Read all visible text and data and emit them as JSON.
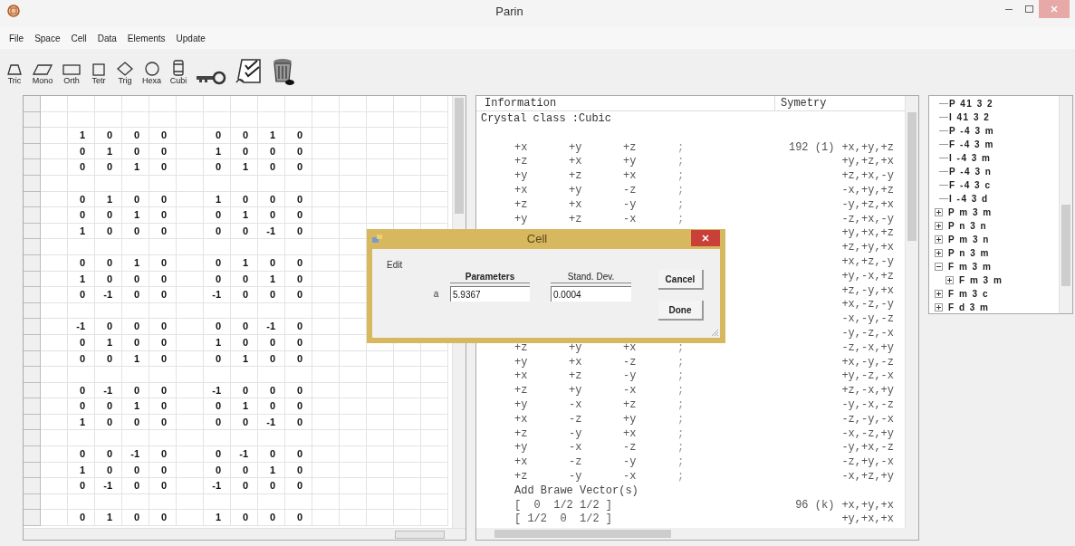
{
  "window": {
    "title": "Parin"
  },
  "menu": [
    "File",
    "Space",
    "Cell",
    "Data",
    "Elements",
    "Update"
  ],
  "toolbar": [
    {
      "label": "Tric",
      "kind": "trapezoid"
    },
    {
      "label": "Mono",
      "kind": "parallelogram"
    },
    {
      "label": "Orth",
      "kind": "rectangle"
    },
    {
      "label": "Tetr",
      "kind": "square"
    },
    {
      "label": "Trig",
      "kind": "diamond"
    },
    {
      "label": "Hexa",
      "kind": "circle"
    },
    {
      "label": "Cubi",
      "kind": "cylinder"
    },
    {
      "kind": "key"
    },
    {
      "kind": "checklist"
    },
    {
      "kind": "trash"
    }
  ],
  "matrix_grid": {
    "groups": [
      {
        "rows": [
          [
            "1",
            "0",
            "0",
            "0",
            "0",
            "0",
            "1",
            "0"
          ],
          [
            "0",
            "1",
            "0",
            "0",
            "1",
            "0",
            "0",
            "0"
          ],
          [
            "0",
            "0",
            "1",
            "0",
            "0",
            "1",
            "0",
            "0"
          ]
        ]
      },
      {
        "rows": [
          [
            "0",
            "1",
            "0",
            "0",
            "1",
            "0",
            "0",
            "0"
          ],
          [
            "0",
            "0",
            "1",
            "0",
            "0",
            "1",
            "0",
            "0"
          ],
          [
            "1",
            "0",
            "0",
            "0",
            "0",
            "0",
            "-1",
            "0"
          ]
        ]
      },
      {
        "rows": [
          [
            "0",
            "0",
            "1",
            "0",
            "0",
            "1",
            "0",
            "0"
          ],
          [
            "1",
            "0",
            "0",
            "0",
            "0",
            "0",
            "1",
            "0"
          ],
          [
            "0",
            "-1",
            "0",
            "0",
            "-1",
            "0",
            "0",
            "0"
          ]
        ]
      },
      {
        "rows": [
          [
            "-1",
            "0",
            "0",
            "0",
            "0",
            "0",
            "-1",
            "0"
          ],
          [
            "0",
            "1",
            "0",
            "0",
            "1",
            "0",
            "0",
            "0"
          ],
          [
            "0",
            "0",
            "1",
            "0",
            "0",
            "1",
            "0",
            "0"
          ]
        ]
      },
      {
        "rows": [
          [
            "0",
            "-1",
            "0",
            "0",
            "-1",
            "0",
            "0",
            "0"
          ],
          [
            "0",
            "0",
            "1",
            "0",
            "0",
            "1",
            "0",
            "0"
          ],
          [
            "1",
            "0",
            "0",
            "0",
            "0",
            "0",
            "-1",
            "0"
          ]
        ]
      },
      {
        "rows": [
          [
            "0",
            "0",
            "-1",
            "0",
            "0",
            "-1",
            "0",
            "0"
          ],
          [
            "1",
            "0",
            "0",
            "0",
            "0",
            "0",
            "1",
            "0"
          ],
          [
            "0",
            "-1",
            "0",
            "0",
            "-1",
            "0",
            "0",
            "0"
          ]
        ]
      },
      {
        "rows": [
          [
            "0",
            "1",
            "0",
            "0",
            "1",
            "0",
            "0",
            "0"
          ]
        ]
      }
    ]
  },
  "info_panel": {
    "columns": [
      "Information",
      "Symetry"
    ],
    "crystal_class": "Crystal class :Cubic",
    "rows": [
      {
        "ops": [
          "+x",
          "+y",
          "+z",
          ";"
        ],
        "multiplicity": "192 (1)",
        "symmetry": "+x,+y,+z"
      },
      {
        "ops": [
          "+z",
          "+x",
          "+y",
          ";"
        ],
        "symmetry": "+y,+z,+x"
      },
      {
        "ops": [
          "+y",
          "+z",
          "+x",
          ";"
        ],
        "symmetry": "+z,+x,-y"
      },
      {
        "ops": [
          "+x",
          "+y",
          "-z",
          ";"
        ],
        "symmetry": "-x,+y,+z"
      },
      {
        "ops": [
          "+z",
          "+x",
          "-y",
          ";"
        ],
        "symmetry": "-y,+z,+x"
      },
      {
        "ops": [
          "+y",
          "+z",
          "-x",
          ";"
        ],
        "symmetry": "-z,+x,-y"
      },
      {
        "symmetry": "+y,+x,+z"
      },
      {
        "symmetry": "+z,+y,+x"
      },
      {
        "symmetry": "+x,+z,-y"
      },
      {
        "symmetry": "+y,-x,+z"
      },
      {
        "symmetry": "+z,-y,+x"
      },
      {
        "symmetry": "+x,-z,-y"
      },
      {
        "symmetry": "-x,-y,-z"
      },
      {
        "symmetry": "-y,-z,-x"
      },
      {
        "ops": [
          "+z",
          "+y",
          "+x",
          ";"
        ],
        "symmetry": "-z,-x,+y"
      },
      {
        "ops": [
          "+y",
          "+x",
          "-z",
          ";"
        ],
        "symmetry": "+x,-y,-z"
      },
      {
        "ops": [
          "+x",
          "+z",
          "-y",
          ";"
        ],
        "symmetry": "+y,-z,-x"
      },
      {
        "ops": [
          "+z",
          "+y",
          "-x",
          ";"
        ],
        "symmetry": "+z,-x,+y"
      },
      {
        "ops": [
          "+y",
          "-x",
          "+z",
          ";"
        ],
        "symmetry": "-y,-x,-z"
      },
      {
        "ops": [
          "+x",
          "-z",
          "+y",
          ";"
        ],
        "symmetry": "-z,-y,-x"
      },
      {
        "ops": [
          "+z",
          "-y",
          "+x",
          ";"
        ],
        "symmetry": "-x,-z,+y"
      },
      {
        "ops": [
          "+y",
          "-x",
          "-z",
          ";"
        ],
        "symmetry": "-y,+x,-z"
      },
      {
        "ops": [
          "+x",
          "-z",
          "-y",
          ";"
        ],
        "symmetry": "-z,+y,-x"
      },
      {
        "ops": [
          "+z",
          "-y",
          "-x",
          ";"
        ],
        "symmetry": "-x,+z,+y"
      }
    ],
    "brave_title": "Add Brawe Vector(s)",
    "vectors": [
      {
        "text": "[  0  1/2 1/2 ]",
        "multiplicity": "96 (k)",
        "symmetry": "+x,+y,+x"
      },
      {
        "text": "[ 1/2  0  1/2 ]",
        "symmetry": "+y,+x,+x"
      }
    ]
  },
  "space_group_tree": [
    {
      "label": "P 41 3 2"
    },
    {
      "label": "I 41 3 2"
    },
    {
      "label": "P -4 3 m"
    },
    {
      "label": "F -4 3 m"
    },
    {
      "label": "I -4 3 m"
    },
    {
      "label": "P -4 3 n"
    },
    {
      "label": "F -4 3 c"
    },
    {
      "label": "I -4 3 d"
    },
    {
      "label": "P m 3 m",
      "expanded": false
    },
    {
      "label": "P n 3 n",
      "expanded": false
    },
    {
      "label": "P m 3 n",
      "expanded": false
    },
    {
      "label": "P n 3 m",
      "expanded": false
    },
    {
      "label": "F m 3 m",
      "expanded": true,
      "children": [
        {
          "label": "F m 3 m",
          "expanded": false
        }
      ]
    },
    {
      "label": "F m 3 c",
      "expanded": false
    },
    {
      "label": "F d 3 m",
      "expanded": false
    }
  ],
  "dialog": {
    "title": "Cell",
    "menu": "Edit",
    "columns": [
      "Parameters",
      "Stand. Dev."
    ],
    "rows": [
      {
        "label": "a",
        "value": "5.9367",
        "deviation": "0.0004"
      }
    ],
    "buttons": [
      "Cancel",
      "Done"
    ]
  }
}
